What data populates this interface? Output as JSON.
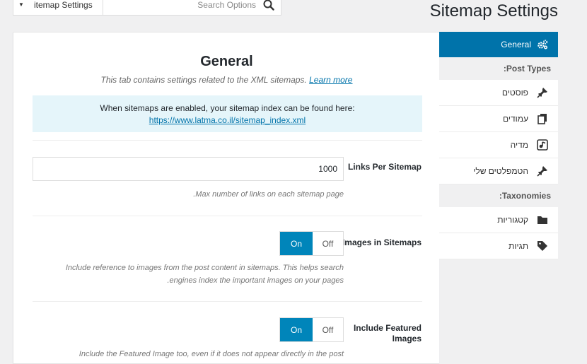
{
  "topbar": {
    "select_label": "itemap Settings",
    "search_placeholder": "Search Options"
  },
  "page_title": "Sitemap Settings",
  "panel": {
    "title": "General",
    "description": "This tab contains settings related to the XML sitemaps.",
    "learn_more": "Learn more",
    "notice_text": "When sitemaps are enabled, your sitemap index can be found here:",
    "notice_link": "https://www.latma.co.il/sitemap_index.xml",
    "fields": {
      "links_per_sitemap": {
        "label": "Links Per Sitemap",
        "value": "1000",
        "help": ".Max number of links on each sitemap page"
      },
      "images_in_sitemaps": {
        "label": "Images in Sitemaps",
        "on": "On",
        "off": "Off",
        "state": "On",
        "help_line1": "Include reference to images from the post content in sitemaps. This helps search",
        "help_line2": ".engines index the important images on your pages"
      },
      "include_featured_images": {
        "label": "Include Featured Images",
        "on": "On",
        "off": "Off",
        "state": "On",
        "help_line1": "Include the Featured Image too, even if it does not appear directly in the post"
      }
    }
  },
  "sidebar": {
    "active_item": "General",
    "post_types_heading": ":Post Types",
    "post_types": [
      "פוסטים",
      "עמודים",
      "מדיה",
      "הטמפלטים שלי"
    ],
    "taxonomies_heading": ":Taxonomies",
    "taxonomies": [
      "קטגוריות",
      "תגיות"
    ]
  },
  "colors": {
    "accent": "#0073aa",
    "toggle_on": "#0085ba",
    "notice_bg": "#e5f5fa",
    "page_bg": "#f0f0f1"
  }
}
